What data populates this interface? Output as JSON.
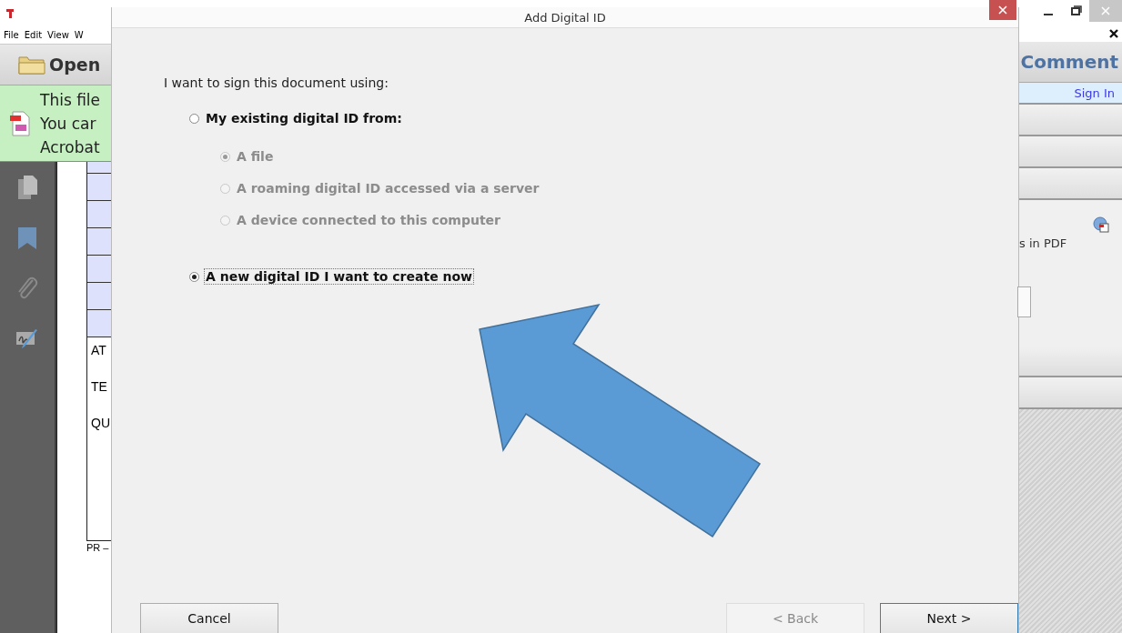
{
  "app": {
    "menu": [
      "File",
      "Edit",
      "View",
      "W"
    ],
    "open_button": "Open",
    "notice_lines": [
      "This file",
      "You car",
      "Acrobat"
    ],
    "document_texts": [
      "AT",
      "TE",
      "QU",
      "PR –"
    ],
    "comment_label": "Comment",
    "sign_in": "Sign In",
    "panel_text": "s in PDF"
  },
  "dialog": {
    "title": "Add Digital ID",
    "prompt": "I want to sign this document using:",
    "options": [
      {
        "label": "My existing digital ID from:",
        "selected": false,
        "disabled": false,
        "focused": false,
        "children": [
          {
            "label": "A file",
            "selected": true,
            "disabled": true
          },
          {
            "label": "A roaming digital ID accessed via a server",
            "selected": false,
            "disabled": true
          },
          {
            "label": "A device connected to this computer",
            "selected": false,
            "disabled": true
          }
        ]
      },
      {
        "label": "A new digital ID I want to create now",
        "selected": true,
        "disabled": false,
        "focused": true
      }
    ],
    "buttons": [
      {
        "label": "Cancel",
        "disabled": false,
        "default": false
      },
      {
        "label": "< Back",
        "disabled": true,
        "default": false
      },
      {
        "label": "Next >",
        "disabled": false,
        "default": true
      }
    ]
  }
}
